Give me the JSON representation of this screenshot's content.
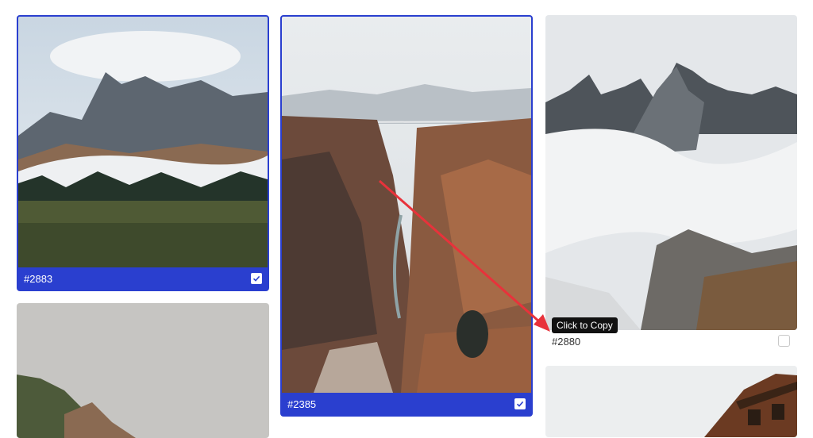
{
  "cards": [
    {
      "id_label": "#2883",
      "selected": true,
      "image": "mountains-fog-meadow"
    },
    {
      "id_label": "#2385",
      "selected": true,
      "image": "canyon-river-bridge"
    },
    {
      "id_label": "#2880",
      "selected": false,
      "image": "dolomites-clouds"
    },
    {
      "image": "foggy-hillside"
    },
    {
      "image": "wooden-cabin-roof"
    }
  ],
  "tooltip": {
    "text": "Click to Copy"
  },
  "colors": {
    "selected_accent": "#2a3fcf",
    "annotation_arrow": "#e8323b"
  }
}
